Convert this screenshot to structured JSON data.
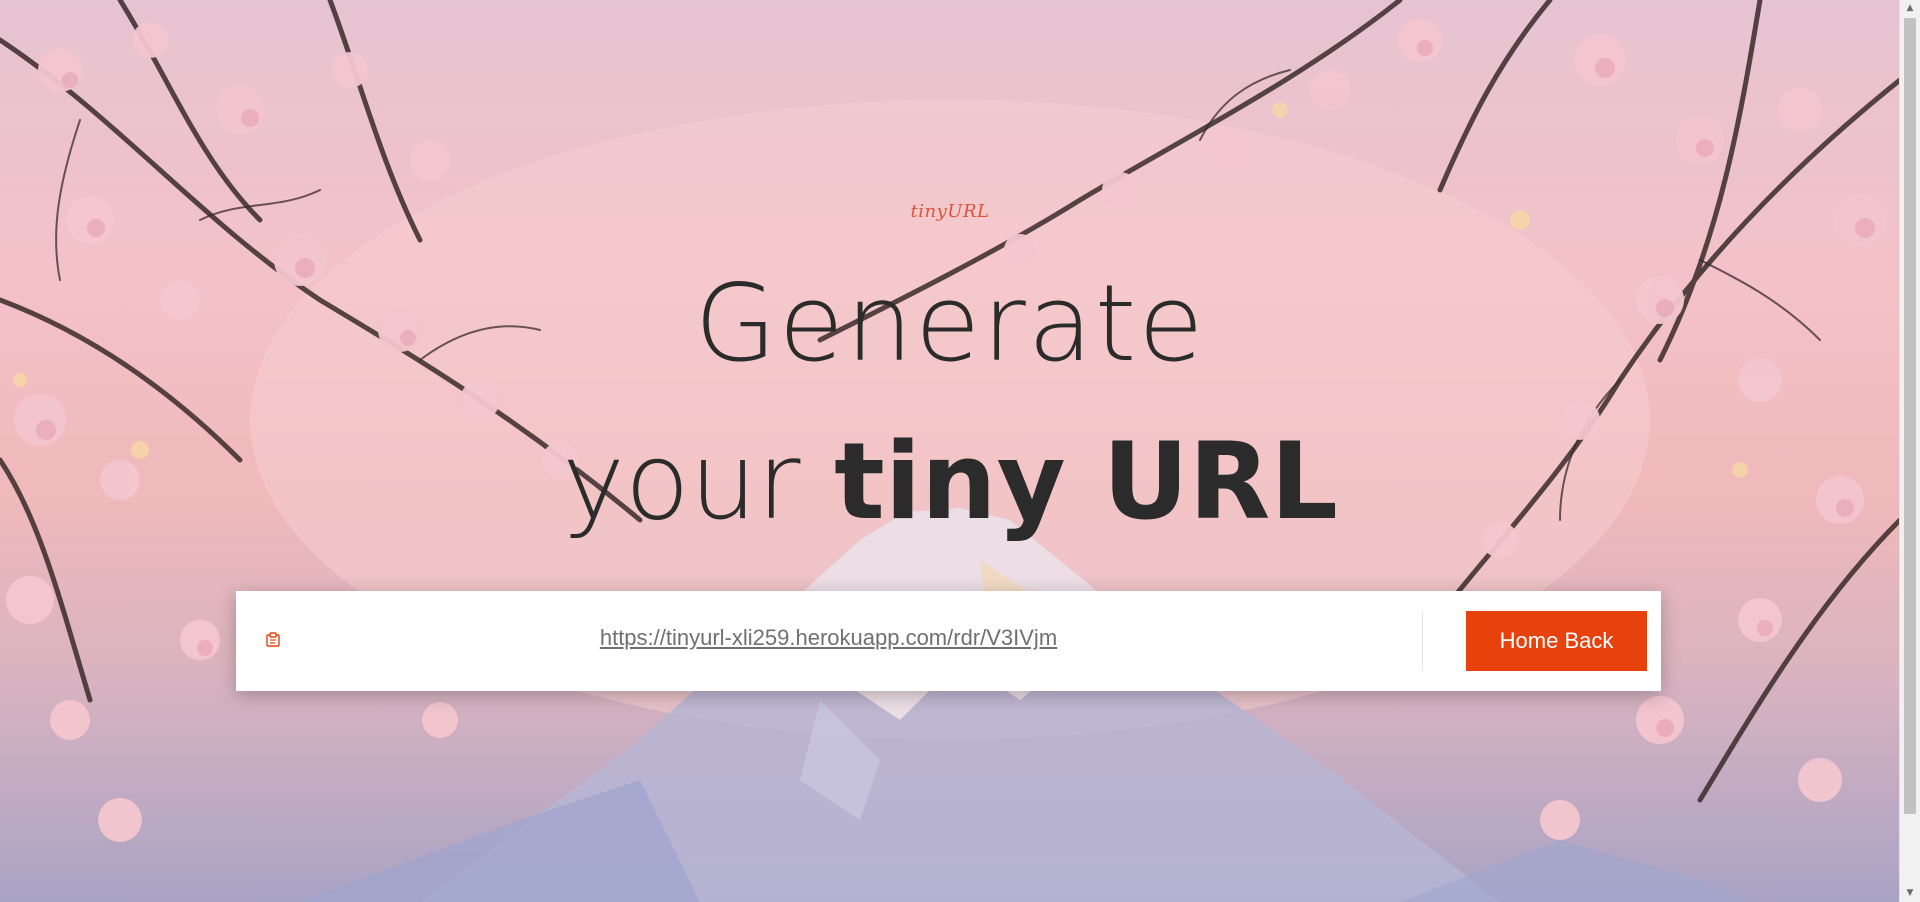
{
  "brand": {
    "logo_text": "tinyURL"
  },
  "hero": {
    "line1": "Generate",
    "line2_prefix": "your ",
    "line2_bold": "tiny URL"
  },
  "result": {
    "short_url": "https://tinyurl-xli259.herokuapp.com/rdr/V3IVjm",
    "copy_icon": "clipboard-icon",
    "home_button_label": "Home Back"
  },
  "colors": {
    "accent": "#e8420c",
    "brand_text": "#e0533b",
    "hero_text": "#2b2b2b",
    "link_text": "#707070"
  },
  "scrollbar": {
    "up_icon": "scroll-up-arrow-icon",
    "down_icon": "scroll-down-arrow-icon"
  }
}
